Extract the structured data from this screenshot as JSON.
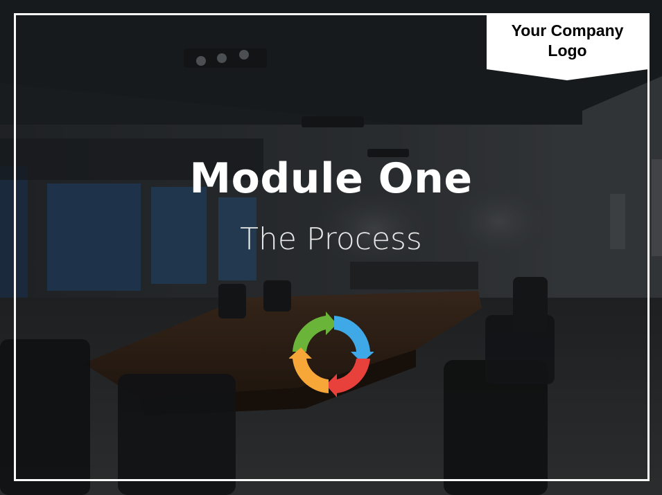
{
  "logo": {
    "text_line1": "Your Company",
    "text_line2": "Logo"
  },
  "slide": {
    "title": "Module One",
    "subtitle": "The Process"
  },
  "icon": {
    "name": "process-cycle-icon",
    "colors": {
      "green": "#6ab43a",
      "blue": "#3fa9e8",
      "red": "#e8403a",
      "orange": "#f7a638"
    }
  },
  "colors": {
    "frame": "#ffffff",
    "title": "#ffffff",
    "subtitle": "#e8e8e8",
    "logo_bg": "#ffffff"
  }
}
